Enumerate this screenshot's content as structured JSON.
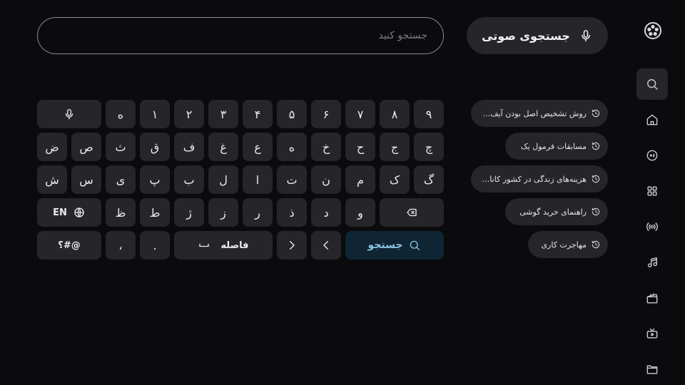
{
  "app": {
    "logo": "film-reel-icon"
  },
  "sidebar": {
    "items": [
      {
        "name": "search",
        "icon": "search-icon",
        "active": true
      },
      {
        "name": "home",
        "icon": "home-icon"
      },
      {
        "name": "games",
        "icon": "gamepad-icon"
      },
      {
        "name": "apps",
        "icon": "grid-icon"
      },
      {
        "name": "live",
        "icon": "broadcast-icon"
      },
      {
        "name": "music",
        "icon": "music-icon"
      },
      {
        "name": "movies",
        "icon": "clapperboard-icon"
      },
      {
        "name": "tv",
        "icon": "tv-icon"
      },
      {
        "name": "files",
        "icon": "folder-icon"
      }
    ]
  },
  "search": {
    "voice_label": "جستجوی صوتی",
    "placeholder": "جستجو کنید",
    "value": ""
  },
  "history": [
    "روش تشخیص اصل بودن آیف...",
    "مسابقات فرمول یک",
    "هزینه‌های زندگی در کشور کاناد...",
    "راهنمای خرید گوشی",
    "مهاجرت کاری"
  ],
  "keyboard": {
    "row1": [
      "mic",
      "ه",
      "۱",
      "۲",
      "۳",
      "۴",
      "۵",
      "۶",
      "۷",
      "۸",
      "۹"
    ],
    "row2": [
      "ض",
      "ص",
      "ث",
      "ق",
      "ف",
      "غ",
      "ع",
      "ه",
      "خ",
      "ح",
      "ج",
      "چ"
    ],
    "row3": [
      "ش",
      "س",
      "ی",
      "پ",
      "ب",
      "ل",
      "ا",
      "ت",
      "ن",
      "م",
      "ک",
      "گ"
    ],
    "row4": [
      "EN",
      "ظ",
      "ط",
      "ژ",
      "ز",
      "ر",
      "ذ",
      "د",
      "و",
      "backspace"
    ],
    "symbols_label": "؟#@",
    "comma": "،",
    "period": ".",
    "space_label": "فاصله",
    "search_label": "جستجو",
    "lang_label": "EN"
  },
  "colors": {
    "background": "#0b0b0d",
    "key": "#25252a",
    "accent": "#8fc4e6",
    "accent_bg": "#0f2534"
  }
}
